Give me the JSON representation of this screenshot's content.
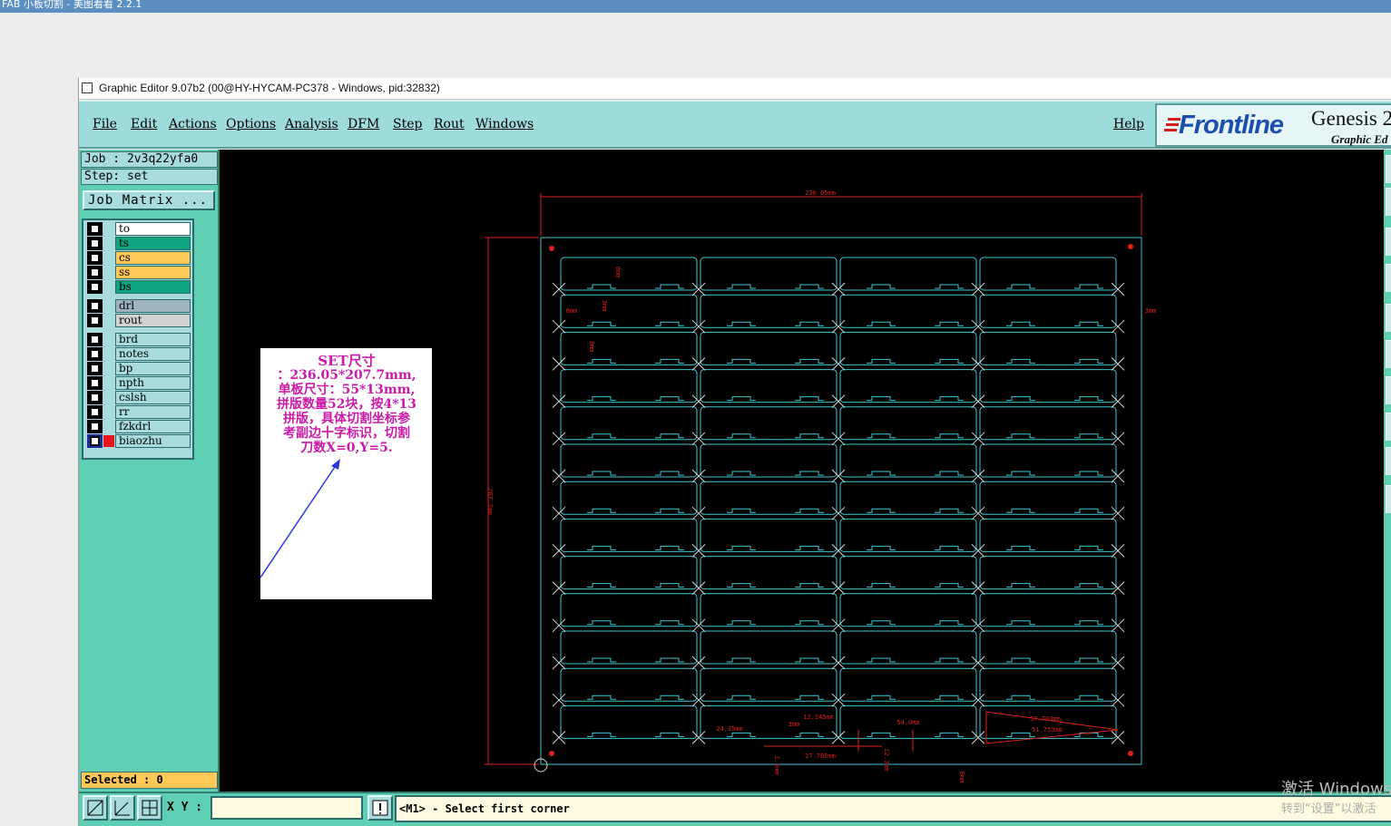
{
  "outer_window": {
    "title": "FAB 小板切割 - 美图看看 2.2.1"
  },
  "window": {
    "title": "Graphic Editor 9.07b2 (00@HY-HYCAM-PC378 - Windows, pid:32832)"
  },
  "menu": {
    "items": [
      {
        "label": "File"
      },
      {
        "label": "Edit"
      },
      {
        "label": "Actions"
      },
      {
        "label": "Options"
      },
      {
        "label": "Analysis"
      },
      {
        "label": "DFM"
      },
      {
        "label": "Step"
      },
      {
        "label": "Rout"
      },
      {
        "label": "Windows"
      }
    ],
    "help": "Help"
  },
  "logo": {
    "brand": "Frontline",
    "product": "Genesis 2",
    "subtitle": "Graphic Ed"
  },
  "job_panel": {
    "job": "Job : 2v3q22yfa0",
    "step": "Step: set",
    "matrix_button": "Job Matrix ..."
  },
  "layers": [
    {
      "name": "to",
      "color": "#ffffff"
    },
    {
      "name": "ts",
      "color": "#0fa37f"
    },
    {
      "name": "cs",
      "color": "#ffc957"
    },
    {
      "name": "ss",
      "color": "#ffc957"
    },
    {
      "name": "bs",
      "color": "#0fa37f"
    },
    {
      "name": "drl",
      "color": "#9fb4c0"
    },
    {
      "name": "rout",
      "color": "#d2d2d2"
    },
    {
      "name": "brd",
      "color": "#a8dcdc"
    },
    {
      "name": "notes",
      "color": "#a8dcdc"
    },
    {
      "name": "bp",
      "color": "#a8dcdc"
    },
    {
      "name": "npth",
      "color": "#a8dcdc"
    },
    {
      "name": "cslsh",
      "color": "#a8dcdc"
    },
    {
      "name": "rr",
      "color": "#a8dcdc"
    },
    {
      "name": "fzkdrl",
      "color": "#a8dcdc"
    },
    {
      "name": "biaozhu",
      "color": "#a8dcdc",
      "active": true
    }
  ],
  "selected": "Selected : 0",
  "xy_label": "X Y :",
  "xy_value": "",
  "status_prompt": "<M1> - Select first corner",
  "annotation": {
    "lines": [
      "SET尺寸",
      "：236.05*207.7mm,",
      "单板尺寸：55*13mm,",
      "拼版数量52块，按4*13",
      "拼版，具体切割坐标参",
      "考副边十字标识，切割",
      "刀数X=0,Y=5."
    ],
    "color": "#cc1aa8"
  },
  "drawing": {
    "columns": 4,
    "rows": 13,
    "board_color": "#3fc8d2",
    "dimension_color": "#dd1f1f",
    "dim_labels": [
      "236.05mm",
      "207.7mm",
      "8mm",
      "3mm",
      "8mm",
      "3mm",
      "3mm",
      "12.245mm",
      "24.35mm",
      "3mm",
      "54.0mm",
      "57.703mm",
      "51.753mm",
      "17.785mm",
      "12.3mm",
      "1.5mm",
      "8mm"
    ]
  },
  "watermark": {
    "line1": "激活 Windows",
    "line2": "转到“设置”以激活"
  }
}
